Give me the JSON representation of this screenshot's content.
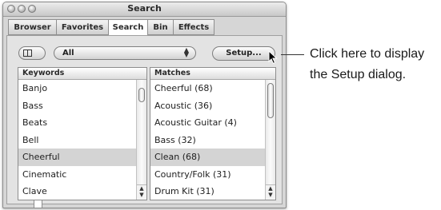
{
  "window": {
    "title": "Search"
  },
  "tabs": [
    {
      "label": "Browser"
    },
    {
      "label": "Favorites"
    },
    {
      "label": "Search"
    },
    {
      "label": "Bin"
    },
    {
      "label": "Effects"
    }
  ],
  "toolbar": {
    "category_popup_value": "All",
    "setup_button_label": "Setup..."
  },
  "keywords": {
    "header": "Keywords",
    "items": [
      "Banjo",
      "Bass",
      "Beats",
      "Bell",
      "Cheerful",
      "Cinematic",
      "Clave"
    ],
    "selected": "Cheerful"
  },
  "matches": {
    "header": "Matches",
    "items": [
      "Cheerful (68)",
      "Acoustic (36)",
      "Acoustic Guitar (4)",
      "Bass (32)",
      "Clean (68)",
      "Country/Folk (31)",
      "Drum Kit (31)"
    ],
    "selected": "Clean (68)"
  },
  "callout": {
    "line1": "Click here to display",
    "line2": "the Setup dialog."
  }
}
